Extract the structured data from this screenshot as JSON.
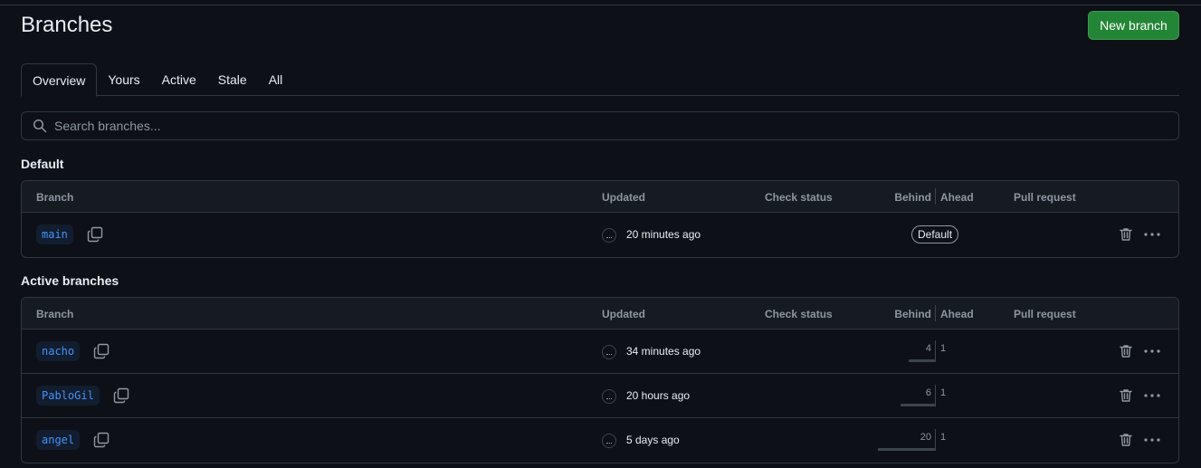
{
  "header": {
    "title": "Branches",
    "new_branch_label": "New branch"
  },
  "tabs": [
    {
      "label": "Overview",
      "selected": true
    },
    {
      "label": "Yours"
    },
    {
      "label": "Active"
    },
    {
      "label": "Stale"
    },
    {
      "label": "All"
    }
  ],
  "search": {
    "placeholder": "Search branches...",
    "value": ""
  },
  "columns": {
    "branch": "Branch",
    "updated": "Updated",
    "check_status": "Check status",
    "behind": "Behind",
    "ahead": "Ahead",
    "pull_request": "Pull request"
  },
  "default_section": {
    "title": "Default",
    "rows": [
      {
        "name": "main",
        "updated": "20 minutes ago",
        "badge": "Default"
      }
    ]
  },
  "active_section": {
    "title": "Active branches",
    "rows": [
      {
        "name": "nacho",
        "updated": "34 minutes ago",
        "behind": "4",
        "ahead": "1"
      },
      {
        "name": "PabloGil",
        "updated": "20 hours ago",
        "behind": "6",
        "ahead": "1"
      },
      {
        "name": "angel",
        "updated": "5 days ago",
        "behind": "20",
        "ahead": "1"
      }
    ]
  },
  "icons": {
    "search": "search-icon",
    "copy": "copy-icon",
    "trash": "trash-icon",
    "kebab": "kebab-horizontal-icon",
    "avatar": "avatar"
  },
  "colors": {
    "background": "#0d1117",
    "accent_green": "#238636",
    "branch_blue": "#4493f8",
    "border": "#30363d",
    "muted": "#8d96a0"
  }
}
